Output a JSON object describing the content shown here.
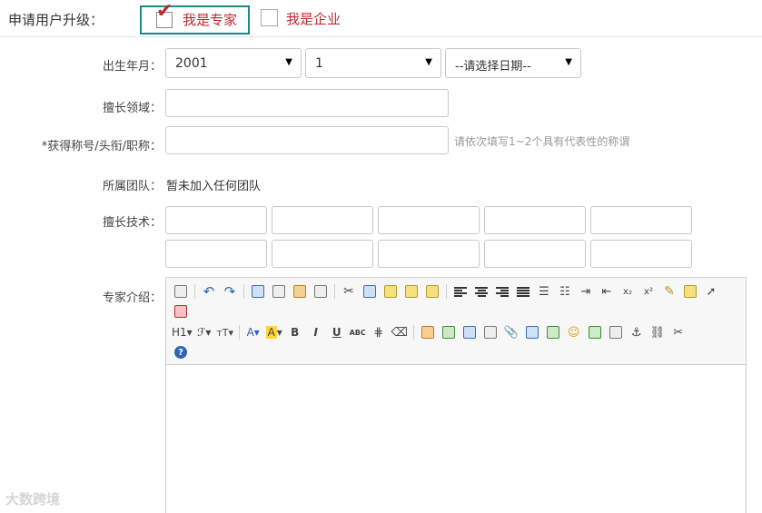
{
  "header": {
    "apply_label": "申请用户升级：",
    "option_expert": "我是专家",
    "option_company": "我是企业",
    "selected_option": "我是专家"
  },
  "form": {
    "birth_label": "出生年月：",
    "birth_year": "2001",
    "birth_month": "1",
    "birth_day": "--请选择日期--",
    "field_label": "擅长领域：",
    "title_label": "*获得称号/头衔/职称：",
    "title_hint": "请依次填写1~2个具有代表性的称谓",
    "team_label": "所属团队：",
    "team_value": "暂未加入任何团队",
    "skills_label": "擅长技术：",
    "intro_label": "专家介绍："
  },
  "editor_toolbar": {
    "heading_btn": "H1",
    "font_family_btn": "ℱ",
    "font_size_btn": "тT",
    "font_color_btn": "A",
    "highlight_btn": "A",
    "bold_btn": "B",
    "italic_btn": "I",
    "underline_btn": "U",
    "strike_btn": "ABC",
    "subscript_btn": "x₂",
    "superscript_btn": "x²",
    "help_btn": "?"
  },
  "watermark": "大数跨境",
  "colors": {
    "accent_red": "#c0282e",
    "selected_border": "#1a8a8a",
    "hint_gray": "#999999"
  }
}
